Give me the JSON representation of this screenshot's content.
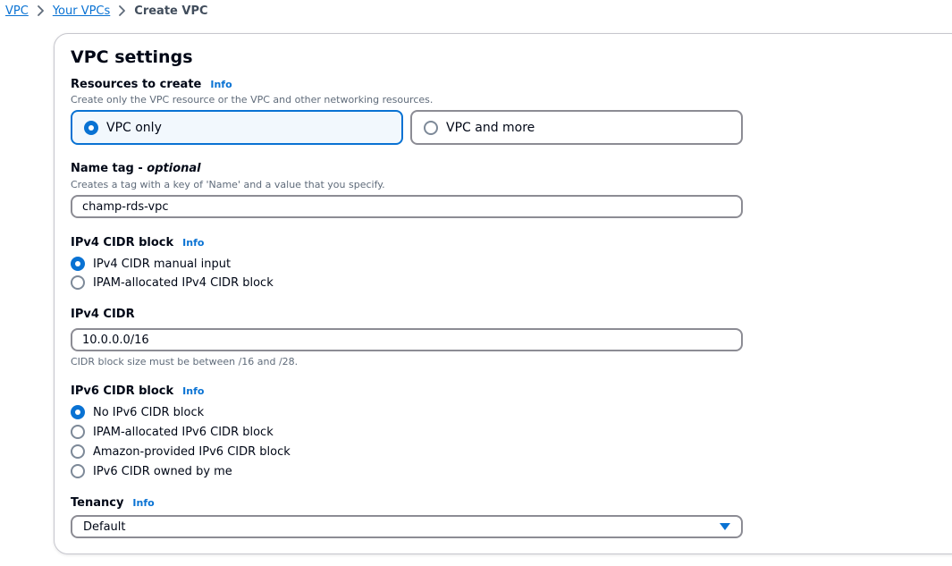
{
  "breadcrumb": {
    "items": [
      "VPC",
      "Your VPCs"
    ],
    "current": "Create VPC",
    "separator": ">"
  },
  "panel": {
    "title": "VPC settings"
  },
  "resources": {
    "label": "Resources to create",
    "info": "Info",
    "description": "Create only the VPC resource or the VPC and other networking resources.",
    "options": [
      "VPC only",
      "VPC and more"
    ],
    "selected": "VPC only"
  },
  "name_tag": {
    "label": "Name tag - ",
    "label_optional": "optional",
    "description": "Creates a tag with a key of 'Name' and a value that you specify.",
    "value": "champ-rds-vpc"
  },
  "ipv4_block": {
    "label": "IPv4 CIDR block",
    "info": "Info",
    "options": [
      "IPv4 CIDR manual input",
      "IPAM-allocated IPv4 CIDR block"
    ],
    "selected": "IPv4 CIDR manual input"
  },
  "ipv4_cidr": {
    "label": "IPv4 CIDR",
    "value": "10.0.0.0/16",
    "constraint": "CIDR block size must be between /16 and /28."
  },
  "ipv6_block": {
    "label": "IPv6 CIDR block",
    "info": "Info",
    "options": [
      "No IPv6 CIDR block",
      "IPAM-allocated IPv6 CIDR block",
      "Amazon-provided IPv6 CIDR block",
      "IPv6 CIDR owned by me"
    ],
    "selected": "No IPv6 CIDR block"
  },
  "tenancy": {
    "label": "Tenancy",
    "info": "Info",
    "value": "Default",
    "icon": "caret-down-icon"
  },
  "colors": {
    "accent": "#0972d3",
    "selected_tile_bg": "#f2f8fd",
    "text": "#000716",
    "muted": "#5f6b7a",
    "border": "#8c8c94"
  }
}
